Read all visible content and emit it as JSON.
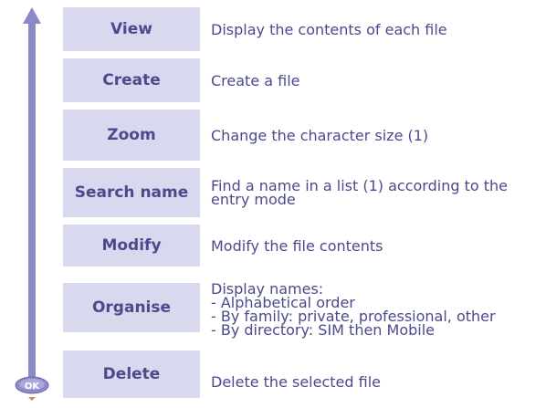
{
  "rows": [
    {
      "label": "View",
      "description": "Display the contents of each file"
    },
    {
      "label": "Create",
      "description": "Create a file"
    },
    {
      "label": "Zoom",
      "description": "Change the character size (1)"
    },
    {
      "label": "Search name",
      "description": "Find a name in a list (1) according to the\nentry mode"
    },
    {
      "label": "Modify",
      "description": "Modify the file contents"
    },
    {
      "label": "Organise",
      "description": "Display names:\n- Alphabetical order\n- By family: private, professional, other\n- By directory: SIM then Mobile"
    },
    {
      "label": "Delete",
      "description": "Delete the selected file"
    }
  ],
  "ok_key": {
    "label": "OK",
    "icon": "ok-navigation-key-icon"
  },
  "scroll_arrow": {
    "icon": "up-arrow-icon"
  },
  "colors": {
    "button_bg": "#d8d8ee",
    "text": "#4a4a8c",
    "arrow": "#8a8ac4",
    "ok_key": "#8a8acc"
  }
}
